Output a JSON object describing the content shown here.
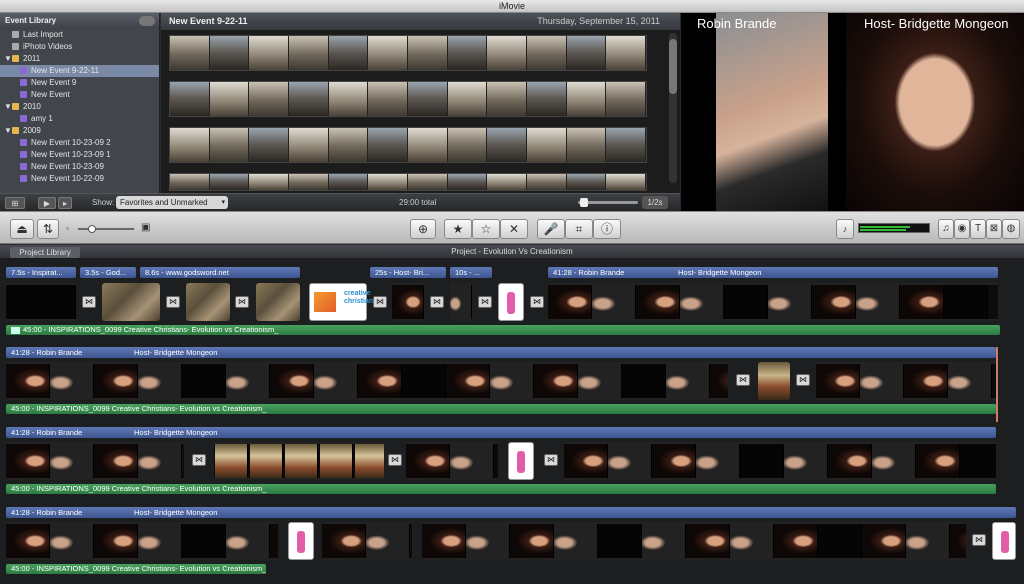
{
  "window": {
    "title": "iMovie"
  },
  "library": {
    "header": "Event Library",
    "items": [
      {
        "label": "Last Import",
        "kind": "import",
        "indent": 1
      },
      {
        "label": "iPhoto Videos",
        "kind": "import",
        "indent": 1
      },
      {
        "label": "2011",
        "kind": "year",
        "indent": 0
      },
      {
        "label": "New Event 9-22-11",
        "kind": "event",
        "indent": 2,
        "selected": true
      },
      {
        "label": "New Event 9",
        "kind": "event",
        "indent": 2
      },
      {
        "label": "New Event",
        "kind": "event",
        "indent": 2
      },
      {
        "label": "2010",
        "kind": "year",
        "indent": 0
      },
      {
        "label": "amy 1",
        "kind": "event",
        "indent": 2
      },
      {
        "label": "2009",
        "kind": "year",
        "indent": 0
      },
      {
        "label": "New Event 10-23-09 2",
        "kind": "event",
        "indent": 2
      },
      {
        "label": "New Event 10-23-09 1",
        "kind": "event",
        "indent": 2
      },
      {
        "label": "New Event 10-23-09",
        "kind": "event",
        "indent": 2
      },
      {
        "label": "New Event 10-22-09",
        "kind": "event",
        "indent": 2
      }
    ]
  },
  "event_browser": {
    "title": "New Event 9-22-11",
    "date": "Thursday, September 15, 2011",
    "show_label": "Show:",
    "filter": "Favorites and Unmarked",
    "total": "29:00 total",
    "zoom": "1/2s"
  },
  "viewer": {
    "left_caption": "Robin Brande",
    "right_caption": "Host- Bridgette Mongeon"
  },
  "project": {
    "library_button": "Project Library",
    "title": "Project - Evolution Vs Creationism"
  },
  "timeline": {
    "row1_titles": [
      "7.5s - Inspirat...",
      "3.5s - God...",
      "8.6s - www.godsword.net",
      "25s - Host- Bri...",
      "10s - ...",
      "41:28 - Robin Brande"
    ],
    "row1_title_extra": "Host- Bridgette Mongeon",
    "title_prefix": "41:28 - Robin Brande",
    "title_extra": "Host- Bridgette Mongeon",
    "audio_label": "45:00 - INSPIRATIONS_0099 Creative Christians- Evolution vs Creationism_",
    "logo_text": "creative christians"
  },
  "colors": {
    "title_bar": "#4a64a3",
    "audio_bar": "#3a8f50",
    "selection": "#7a8aa6",
    "playhead": "#d07a6a"
  }
}
